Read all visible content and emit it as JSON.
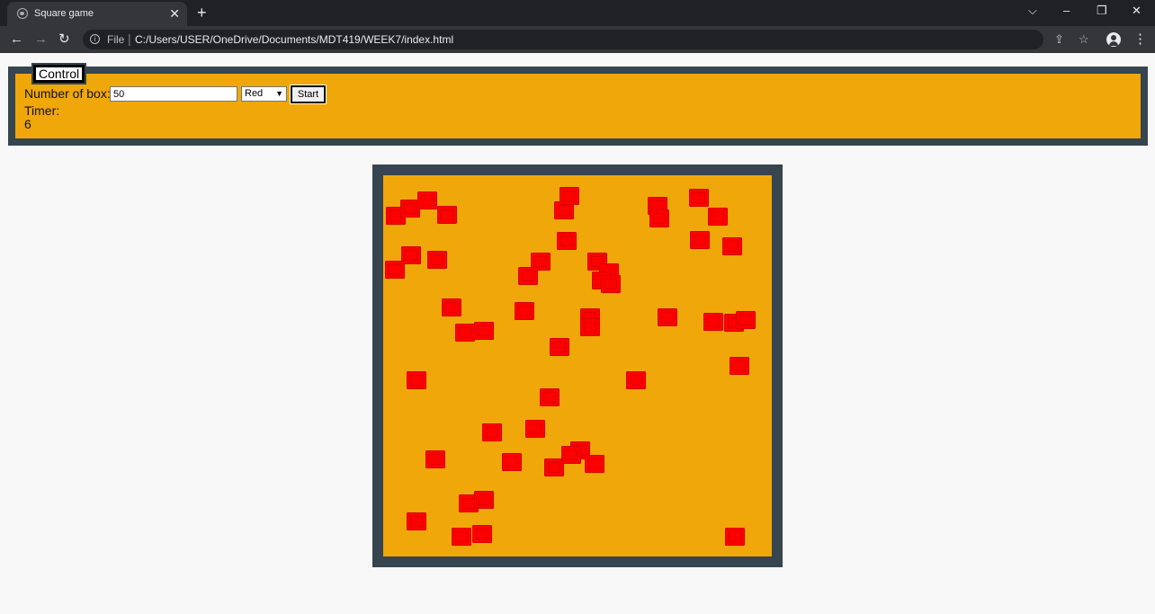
{
  "browser": {
    "tab_title": "Square game",
    "tab_close": "✕",
    "new_tab": "+",
    "file_label": "File",
    "url_separator": "|",
    "url": "C:/Users/USER/OneDrive/Documents/MDT419/WEEK7/index.html",
    "window_controls": {
      "tab_search": "⌵",
      "minimize": "–",
      "restore": "❐",
      "close": "✕"
    },
    "nav": {
      "back": "←",
      "forward": "→",
      "reload": "↻",
      "menu": "⋮"
    },
    "icons": {
      "share": "⇪",
      "bookmark": "☆",
      "info": "i"
    }
  },
  "control": {
    "legend": "Control",
    "number_label": "Number of box:",
    "number_value": "50",
    "color_selected": "Red",
    "start_label": "Start",
    "timer_label": "Timer:",
    "timer_value": "6"
  },
  "game": {
    "square_color": "#ff0000",
    "panel_color": "#f0a70a",
    "border_color": "#36454f",
    "box_count": 50
  }
}
